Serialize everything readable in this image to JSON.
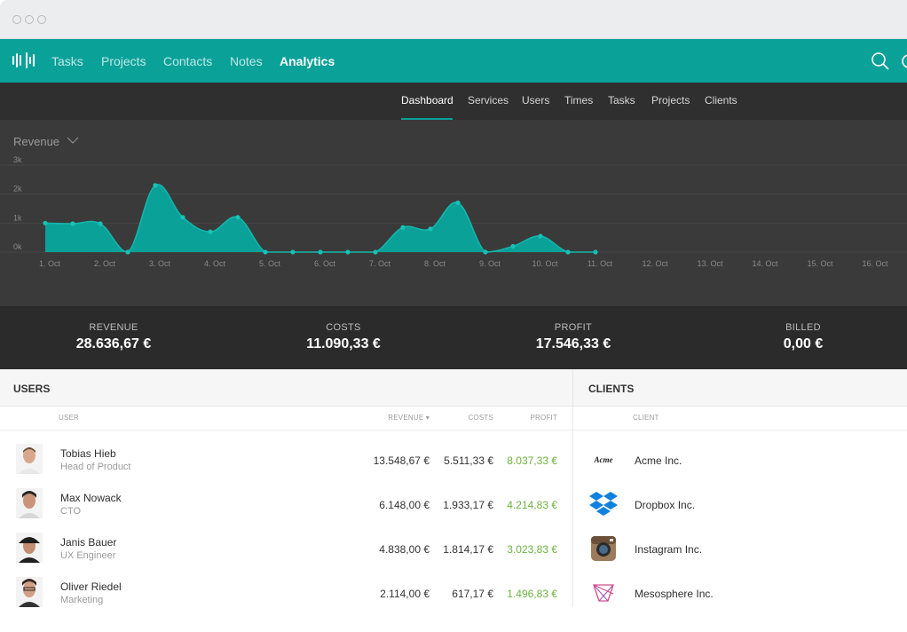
{
  "nav": {
    "links": [
      "Tasks",
      "Projects",
      "Contacts",
      "Notes",
      "Analytics"
    ],
    "active": "Analytics"
  },
  "subnav": {
    "tabs": [
      "Dashboard",
      "Services",
      "Users",
      "Times",
      "Tasks",
      "Projects",
      "Clients"
    ],
    "active": "Dashboard"
  },
  "chart": {
    "metric_label": "Revenue"
  },
  "chart_data": {
    "type": "area",
    "x": [
      "1. Oct",
      "",
      "2. Oct",
      "",
      "3. Oct",
      "",
      "4. Oct",
      "",
      "5. Oct",
      "",
      "6. Oct",
      "",
      "7. Oct",
      "",
      "8. Oct",
      "",
      "9. Oct",
      "",
      "10. Oct",
      "",
      "11. Oct",
      "",
      "12. Oct",
      "",
      "13. Oct",
      "",
      "14. Oct",
      "",
      "15. Oct",
      "",
      "16. Oct",
      ""
    ],
    "tick_labels": [
      "1. Oct",
      "2. Oct",
      "3. Oct",
      "4. Oct",
      "5. Oct",
      "6. Oct",
      "7. Oct",
      "8. Oct",
      "9. Oct",
      "10. Oct",
      "11. Oct",
      "12. Oct",
      "13. Oct",
      "14. Oct",
      "15. Oct",
      "16. Oct"
    ],
    "y_ticks": [
      "0k",
      "1k",
      "2k",
      "3k"
    ],
    "ylim": [
      0,
      3000
    ],
    "series": [
      {
        "values": [
          1000,
          980,
          980,
          0,
          2300,
          1200,
          700,
          1200,
          0,
          0,
          0,
          0,
          0,
          850,
          800,
          1700,
          0,
          200,
          550,
          0,
          0
        ]
      }
    ],
    "accent": "#0aa199",
    "grid": true
  },
  "totals": [
    {
      "label": "REVENUE",
      "value": "28.636,67 €"
    },
    {
      "label": "COSTS",
      "value": "11.090,33 €"
    },
    {
      "label": "PROFIT",
      "value": "17.546,33 €"
    },
    {
      "label": "BILLED",
      "value": "0,00 €"
    }
  ],
  "users": {
    "title": "USERS",
    "columns": {
      "user": "USER",
      "revenue": "REVENUE ▾",
      "costs": "COSTS",
      "profit": "PROFIT"
    },
    "rows": [
      {
        "name": "Tobias Hieb",
        "role": "Head of Product",
        "revenue": "13.548,67 €",
        "costs": "5.511,33 €",
        "profit": "8.037,33 €"
      },
      {
        "name": "Max Nowack",
        "role": "CTO",
        "revenue": "6.148,00 €",
        "costs": "1.933,17 €",
        "profit": "4.214,83 €"
      },
      {
        "name": "Janis Bauer",
        "role": "UX Engineer",
        "revenue": "4.838,00 €",
        "costs": "1.814,17 €",
        "profit": "3.023,83 €"
      },
      {
        "name": "Oliver Riedel",
        "role": "Marketing",
        "revenue": "2.114,00 €",
        "costs": "617,17 €",
        "profit": "1.496,83 €"
      }
    ]
  },
  "clients": {
    "title": "CLIENTS",
    "columns": {
      "client": "CLIENT"
    },
    "rows": [
      {
        "name": "Acme Inc.",
        "logo": "acme-logo",
        "logo_text": "Acme"
      },
      {
        "name": "Dropbox Inc.",
        "logo": "dropbox-logo"
      },
      {
        "name": "Instagram Inc.",
        "logo": "instagram-logo"
      },
      {
        "name": "Mesosphere Inc.",
        "logo": "mesosphere-logo"
      }
    ]
  },
  "colors": {
    "brand": "#0aa199",
    "profit": "#6cb33f"
  }
}
